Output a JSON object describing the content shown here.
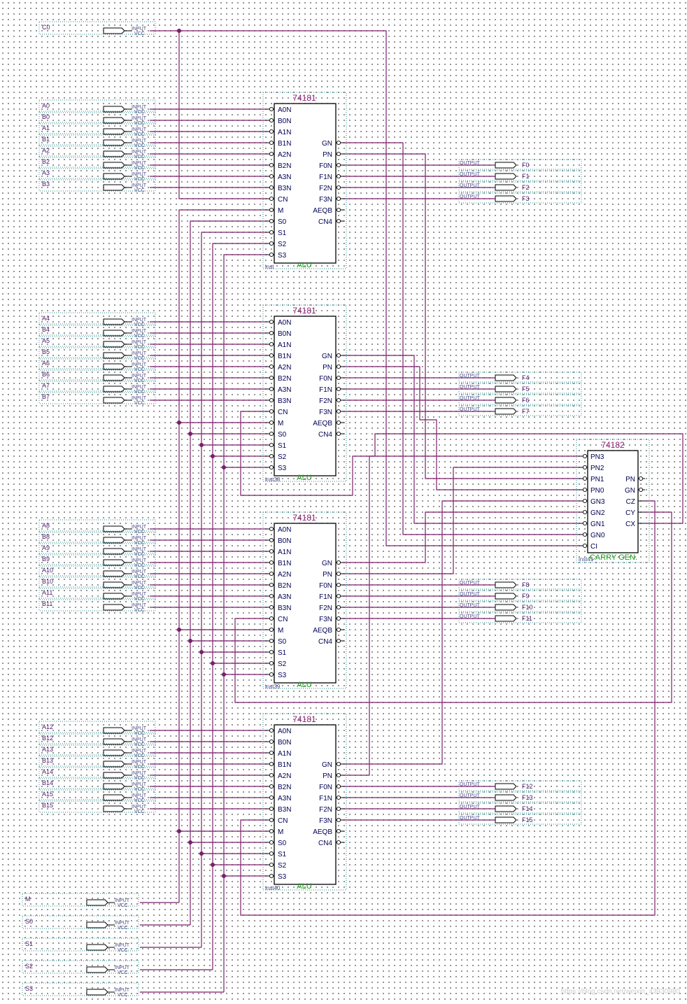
{
  "ports": {
    "input_kind": "INPUT",
    "output_kind": "OUTPUT",
    "vcc": "VCC",
    "c0": "C0",
    "alu_inputs": [
      [
        "A0",
        "B0",
        "A1",
        "B1",
        "A2",
        "B2",
        "A3",
        "B3"
      ],
      [
        "A4",
        "B4",
        "A5",
        "B5",
        "A6",
        "B6",
        "A7",
        "B7"
      ],
      [
        "A8",
        "B8",
        "A9",
        "B9",
        "A10",
        "B10",
        "A11",
        "B11"
      ],
      [
        "A12",
        "B12",
        "A13",
        "B13",
        "A14",
        "B14",
        "A15",
        "B15"
      ]
    ],
    "alu_outputs": [
      [
        "F0",
        "F1",
        "F2",
        "F3"
      ],
      [
        "F4",
        "F5",
        "F6",
        "F7"
      ],
      [
        "F8",
        "F9",
        "F10",
        "F11"
      ],
      [
        "F12",
        "F13",
        "F14",
        "F15"
      ]
    ],
    "controls": [
      "M",
      "S0",
      "S1",
      "S2",
      "S3"
    ]
  },
  "alu": {
    "part": "74181",
    "function": "ALU",
    "instances": [
      "inst",
      "inst38",
      "inst39",
      "inst40"
    ],
    "left_pins": [
      "A0N",
      "B0N",
      "A1N",
      "B1N",
      "A2N",
      "B2N",
      "A3N",
      "B3N",
      "CN",
      "M",
      "S0",
      "S1",
      "S2",
      "S3"
    ],
    "right_pins": [
      "GN",
      "PN",
      "F0N",
      "F1N",
      "F2N",
      "F3N",
      "AEQB",
      "CN4"
    ]
  },
  "carry": {
    "part": "74182",
    "function": "CARRY GEN.",
    "instance": "inst41",
    "left_pins": [
      "PN3",
      "PN2",
      "PN1",
      "PN0",
      "GN3",
      "GN2",
      "GN1",
      "GN0",
      "CI"
    ],
    "right_pins": [
      "PN",
      "GN",
      "CZ",
      "CY",
      "CX"
    ]
  },
  "watermark": "https://blog.csdn.net/weixin_43930980"
}
